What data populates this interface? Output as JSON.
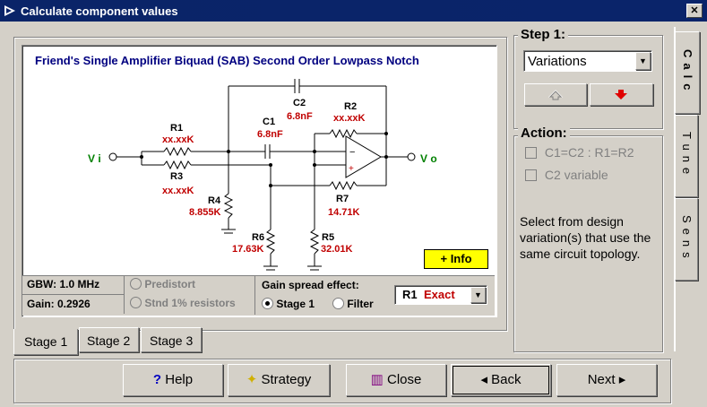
{
  "window": {
    "title": "Calculate component values",
    "close": "✕"
  },
  "diagram": {
    "title": "Friend's Single Amplifier Biquad (SAB) Second Order Lowpass Notch",
    "vi": "V i",
    "vo": "V o",
    "components": {
      "r1": {
        "name": "R1",
        "value": "xx.xxK"
      },
      "r3": {
        "name": "R3",
        "value": "xx.xxK"
      },
      "r4": {
        "name": "R4",
        "value": "8.855K"
      },
      "r6": {
        "name": "R6",
        "value": "17.63K"
      },
      "r5": {
        "name": "R5",
        "value": "32.01K"
      },
      "r7": {
        "name": "R7",
        "value": "14.71K"
      },
      "r2": {
        "name": "R2",
        "value": "xx.xxK"
      },
      "c1": {
        "name": "C1",
        "value": "6.8nF"
      },
      "c2": {
        "name": "C2",
        "value": "6.8nF"
      }
    },
    "info_button": "+ Info"
  },
  "bottom_panel": {
    "gbw": "GBW:  1.0 MHz",
    "gain": "Gain: 0.2926",
    "predistort": "Predistort",
    "stnd": "Stnd 1% resistors",
    "gain_spread_label": "Gain spread effect:",
    "stage1_radio": "Stage 1",
    "filter_radio": "Filter",
    "select_prefix": "R1",
    "select_value": "Exact"
  },
  "stage_tabs": [
    "Stage 1",
    "Stage 2",
    "Stage 3"
  ],
  "step": {
    "label": "Step 1:",
    "dropdown_value": "Variations"
  },
  "action": {
    "label": "Action:",
    "opt1": "C1=C2 : R1=R2",
    "opt2": "C2 variable",
    "description": "Select from design variation(s) that use the same circuit topology."
  },
  "side_tabs": [
    "Calc",
    "Tune",
    "Sens"
  ],
  "buttons": {
    "help": "Help",
    "strategy": "Strategy",
    "close": "Close",
    "back": "Back",
    "next": "Next"
  },
  "colors": {
    "titlebar": "#0a246a",
    "face": "#d4d0c8",
    "value_red": "#c00000",
    "title_blue": "#000080",
    "info_yellow": "#ffff00",
    "terminal_green": "#008000"
  }
}
